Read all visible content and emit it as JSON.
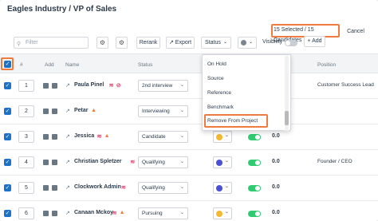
{
  "title": "Eagles Industry / VP of Sales",
  "selection": {
    "text": "15 Selected / 15 Candidates",
    "cancel": "Cancel"
  },
  "toolbar": {
    "filter_placeholder": "Filter",
    "rerank": "Rerank",
    "export": "Export",
    "status": "Status",
    "visibility": "Visibility",
    "add": "+ Add"
  },
  "columns": {
    "num": "#",
    "add": "Add",
    "name": "Name",
    "status": "Status",
    "position": "Position"
  },
  "dropdown": [
    "On Hold",
    "Source",
    "Reference",
    "Benchmark",
    "Remove From Project"
  ],
  "rows": [
    {
      "num": "1",
      "name": "Paula Pinel",
      "status": "2nd interview",
      "dot_color": "",
      "toggle": false,
      "score": "",
      "position": "Customer Success Lead",
      "tags": [
        "pink",
        "block"
      ]
    },
    {
      "num": "2",
      "name": "Petar",
      "status": "Interviewing",
      "dot_color": "",
      "toggle": false,
      "score": "",
      "position": "",
      "tags": [
        "orange"
      ]
    },
    {
      "num": "3",
      "name": "Jessica",
      "status": "Candidate",
      "dot_color": "#f5b82e",
      "toggle": true,
      "score": "0.0",
      "position": "",
      "tags": [
        "pink",
        "orange"
      ]
    },
    {
      "num": "4",
      "name": "Christian Spletzer",
      "status": "Qualifying",
      "dot_color": "#4a4fd6",
      "toggle": true,
      "score": "0.0",
      "position": "Founder / CEO",
      "tags": [
        "pink"
      ]
    },
    {
      "num": "5",
      "name": "Clockwork Admin",
      "status": "Qualifying",
      "dot_color": "#4a4fd6",
      "toggle": true,
      "score": "0.0",
      "position": "",
      "tags": [
        "pink"
      ]
    },
    {
      "num": "6",
      "name": "Canaan Mckoy",
      "status": "Pursuing",
      "dot_color": "#f5b82e",
      "toggle": true,
      "score": "0.0",
      "position": "",
      "tags": [
        "pink",
        "orange"
      ]
    }
  ],
  "colors": {
    "accent": "#1a73c9",
    "highlight": "#f07b3f",
    "tag_pink": "#e6456d",
    "tag_orange": "#f07b3f",
    "toggle_on": "#2ecc71"
  }
}
